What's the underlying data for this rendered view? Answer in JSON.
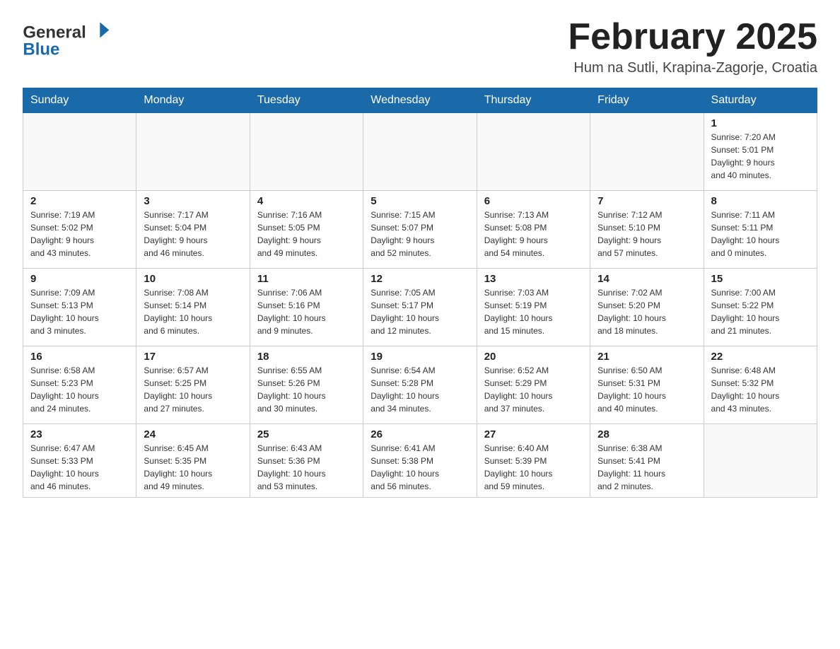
{
  "logo": {
    "text_general": "General",
    "text_blue": "Blue"
  },
  "header": {
    "month_title": "February 2025",
    "location": "Hum na Sutli, Krapina-Zagorje, Croatia"
  },
  "days_of_week": [
    "Sunday",
    "Monday",
    "Tuesday",
    "Wednesday",
    "Thursday",
    "Friday",
    "Saturday"
  ],
  "weeks": [
    {
      "days": [
        {
          "number": "",
          "info": ""
        },
        {
          "number": "",
          "info": ""
        },
        {
          "number": "",
          "info": ""
        },
        {
          "number": "",
          "info": ""
        },
        {
          "number": "",
          "info": ""
        },
        {
          "number": "",
          "info": ""
        },
        {
          "number": "1",
          "info": "Sunrise: 7:20 AM\nSunset: 5:01 PM\nDaylight: 9 hours\nand 40 minutes."
        }
      ]
    },
    {
      "days": [
        {
          "number": "2",
          "info": "Sunrise: 7:19 AM\nSunset: 5:02 PM\nDaylight: 9 hours\nand 43 minutes."
        },
        {
          "number": "3",
          "info": "Sunrise: 7:17 AM\nSunset: 5:04 PM\nDaylight: 9 hours\nand 46 minutes."
        },
        {
          "number": "4",
          "info": "Sunrise: 7:16 AM\nSunset: 5:05 PM\nDaylight: 9 hours\nand 49 minutes."
        },
        {
          "number": "5",
          "info": "Sunrise: 7:15 AM\nSunset: 5:07 PM\nDaylight: 9 hours\nand 52 minutes."
        },
        {
          "number": "6",
          "info": "Sunrise: 7:13 AM\nSunset: 5:08 PM\nDaylight: 9 hours\nand 54 minutes."
        },
        {
          "number": "7",
          "info": "Sunrise: 7:12 AM\nSunset: 5:10 PM\nDaylight: 9 hours\nand 57 minutes."
        },
        {
          "number": "8",
          "info": "Sunrise: 7:11 AM\nSunset: 5:11 PM\nDaylight: 10 hours\nand 0 minutes."
        }
      ]
    },
    {
      "days": [
        {
          "number": "9",
          "info": "Sunrise: 7:09 AM\nSunset: 5:13 PM\nDaylight: 10 hours\nand 3 minutes."
        },
        {
          "number": "10",
          "info": "Sunrise: 7:08 AM\nSunset: 5:14 PM\nDaylight: 10 hours\nand 6 minutes."
        },
        {
          "number": "11",
          "info": "Sunrise: 7:06 AM\nSunset: 5:16 PM\nDaylight: 10 hours\nand 9 minutes."
        },
        {
          "number": "12",
          "info": "Sunrise: 7:05 AM\nSunset: 5:17 PM\nDaylight: 10 hours\nand 12 minutes."
        },
        {
          "number": "13",
          "info": "Sunrise: 7:03 AM\nSunset: 5:19 PM\nDaylight: 10 hours\nand 15 minutes."
        },
        {
          "number": "14",
          "info": "Sunrise: 7:02 AM\nSunset: 5:20 PM\nDaylight: 10 hours\nand 18 minutes."
        },
        {
          "number": "15",
          "info": "Sunrise: 7:00 AM\nSunset: 5:22 PM\nDaylight: 10 hours\nand 21 minutes."
        }
      ]
    },
    {
      "days": [
        {
          "number": "16",
          "info": "Sunrise: 6:58 AM\nSunset: 5:23 PM\nDaylight: 10 hours\nand 24 minutes."
        },
        {
          "number": "17",
          "info": "Sunrise: 6:57 AM\nSunset: 5:25 PM\nDaylight: 10 hours\nand 27 minutes."
        },
        {
          "number": "18",
          "info": "Sunrise: 6:55 AM\nSunset: 5:26 PM\nDaylight: 10 hours\nand 30 minutes."
        },
        {
          "number": "19",
          "info": "Sunrise: 6:54 AM\nSunset: 5:28 PM\nDaylight: 10 hours\nand 34 minutes."
        },
        {
          "number": "20",
          "info": "Sunrise: 6:52 AM\nSunset: 5:29 PM\nDaylight: 10 hours\nand 37 minutes."
        },
        {
          "number": "21",
          "info": "Sunrise: 6:50 AM\nSunset: 5:31 PM\nDaylight: 10 hours\nand 40 minutes."
        },
        {
          "number": "22",
          "info": "Sunrise: 6:48 AM\nSunset: 5:32 PM\nDaylight: 10 hours\nand 43 minutes."
        }
      ]
    },
    {
      "days": [
        {
          "number": "23",
          "info": "Sunrise: 6:47 AM\nSunset: 5:33 PM\nDaylight: 10 hours\nand 46 minutes."
        },
        {
          "number": "24",
          "info": "Sunrise: 6:45 AM\nSunset: 5:35 PM\nDaylight: 10 hours\nand 49 minutes."
        },
        {
          "number": "25",
          "info": "Sunrise: 6:43 AM\nSunset: 5:36 PM\nDaylight: 10 hours\nand 53 minutes."
        },
        {
          "number": "26",
          "info": "Sunrise: 6:41 AM\nSunset: 5:38 PM\nDaylight: 10 hours\nand 56 minutes."
        },
        {
          "number": "27",
          "info": "Sunrise: 6:40 AM\nSunset: 5:39 PM\nDaylight: 10 hours\nand 59 minutes."
        },
        {
          "number": "28",
          "info": "Sunrise: 6:38 AM\nSunset: 5:41 PM\nDaylight: 11 hours\nand 2 minutes."
        },
        {
          "number": "",
          "info": ""
        }
      ]
    }
  ]
}
